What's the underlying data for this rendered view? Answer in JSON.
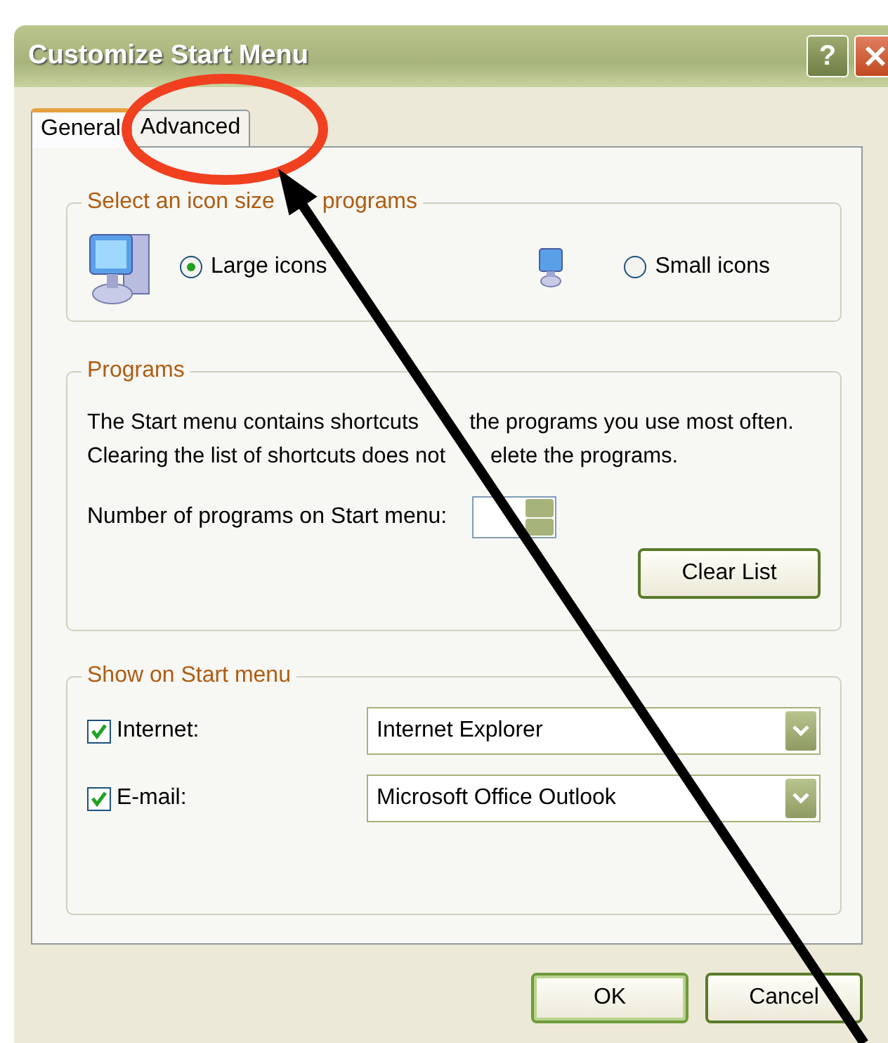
{
  "window": {
    "title": "Customize Start Menu",
    "help_button": "?"
  },
  "tabs": [
    {
      "label": "General",
      "selected": true
    },
    {
      "label": "Advanced",
      "selected": false
    }
  ],
  "icon_size_group": {
    "title_parts": [
      "Select an icon size",
      "programs"
    ],
    "options": [
      {
        "label": "Large icons",
        "kind": "large",
        "selected": true
      },
      {
        "label": "Small icons",
        "kind": "small",
        "selected": false
      }
    ]
  },
  "programs_group": {
    "title": "Programs",
    "description_lines": [
      [
        "The Start menu contains shortcuts",
        "the programs you use most often."
      ],
      [
        "Clearing the list of shortcuts does not",
        "elete the programs."
      ]
    ],
    "count_label": "Number of programs on Start menu:",
    "clear_button": "Clear List"
  },
  "show_group": {
    "title": "Show on Start menu",
    "items": [
      {
        "label": "Internet:",
        "checked": true,
        "value": "Internet Explorer"
      },
      {
        "label": "E-mail:",
        "checked": true,
        "value": "Microsoft Office Outlook"
      }
    ]
  },
  "buttons": [
    "OK",
    "Cancel"
  ]
}
